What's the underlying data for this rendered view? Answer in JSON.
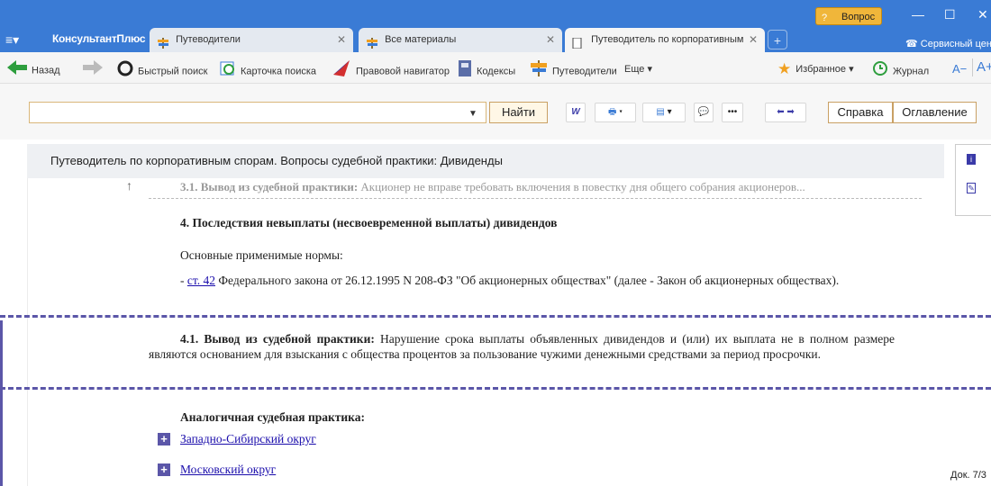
{
  "window": {
    "logo": "КонсультантПлюс",
    "vopros_label": "Вопрос",
    "vopros_badge": "?",
    "service_label": "Сервисный цен",
    "tabs": [
      {
        "label": "Путеводители"
      },
      {
        "label": "Все материалы"
      },
      {
        "label": "Путеводитель по корпоративным сп"
      }
    ]
  },
  "toolbar": {
    "back": "Назад",
    "quick_search": "Быстрый поиск",
    "search_card": "Карточка поиска",
    "legal_navigator": "Правовой навигатор",
    "codes": "Кодексы",
    "guides": "Путеводители",
    "more": "Еще",
    "favorites": "Избранное",
    "journal": "Журнал",
    "font_minus": "A−",
    "font_plus": "A+"
  },
  "search": {
    "placeholder": "",
    "find": "Найти",
    "help": "Справка",
    "toc": "Оглавление"
  },
  "document": {
    "header": "Путеводитель по корпоративным спорам. Вопросы судебной практики: Дивиденды",
    "prev_title": "3.1. Вывод из судебной практики:",
    "prev_text": "Акционер не вправе требовать включения в повестку дня общего собрания акционеров...",
    "section_title": "4. Последствия невыплаты (несвоевременной выплаты) дивидендов",
    "norms_label": "Основные применимые нормы:",
    "norm_prefix": "- ",
    "norm_link": "ст. 42",
    "norm_text": " Федерального закона от 26.12.1995 N 208-ФЗ \"Об акционерных обществах\" (далее - Закон об акционерных обществах).",
    "conclusion_title": "4.1. Вывод из судебной практики:",
    "conclusion_text": " Нарушение срока выплаты объявленных дивидендов и (или) их выплата не в полном размере являются основанием для взыскания с общества процентов за пользование чужими денежными средствами за период просрочки.",
    "similar_title": "Аналогичная судебная практика:",
    "courts": [
      "Западно-Сибирский округ",
      "Московский округ"
    ],
    "doc_counter": "Док. 7/3"
  }
}
